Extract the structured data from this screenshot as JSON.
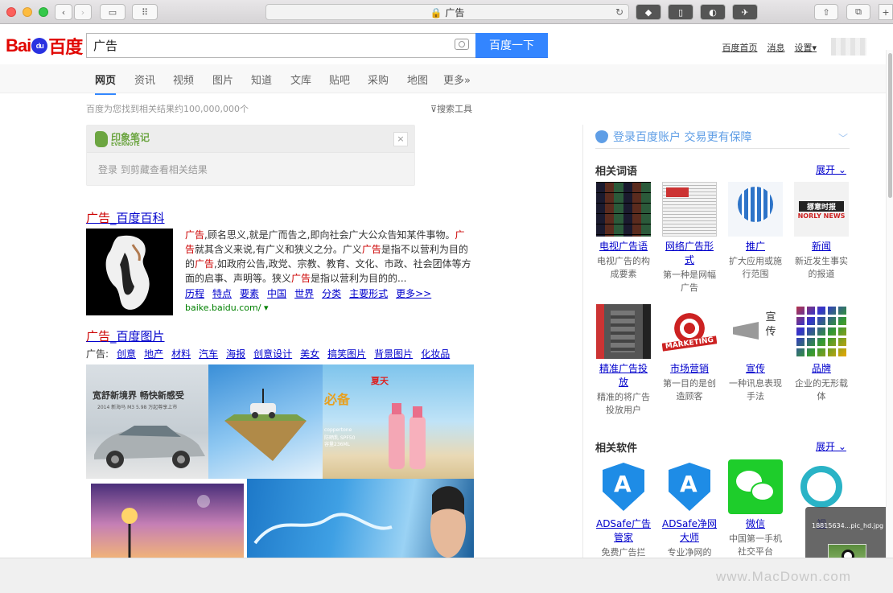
{
  "browser": {
    "address": "🔒 广告",
    "tabs_icon": "tabs-icon"
  },
  "baidu": {
    "logo_left": "Bai",
    "logo_paw": "du",
    "logo_right": "百度",
    "query": "广告",
    "search_button": "百度一下",
    "top_links": [
      "百度首页",
      "消息",
      "设置▾"
    ],
    "nav": [
      "网页",
      "资讯",
      "视频",
      "图片",
      "知道",
      "文库",
      "贴吧",
      "采购",
      "地图",
      "更多»"
    ],
    "result_count": "百度为您找到相关结果约100,000,000个",
    "search_tools": "搜索工具"
  },
  "evernote": {
    "brand": "印象笔记",
    "sub": "EVERNOTE",
    "close": "×",
    "body": "登录 到剪藏查看相关结果"
  },
  "result1": {
    "title_kw": "广告",
    "title_rest": "_百度百科",
    "text_parts": [
      "广告",
      ",顾名思义,就是广而告之,即向社会广大公众告知某件事物。",
      "广告",
      "就其含义来说,有广义和狭义之分。广义",
      "广告",
      "是指不以营利为目的的",
      "广告",
      ",如政府公告,政党、宗教、教育、文化、市政、社会团体等方面的启事、声明等。狭义",
      "广告",
      "是指以营利为目的的..."
    ],
    "links": [
      "历程",
      "特点",
      "要素",
      "中国",
      "世界",
      "分类",
      "主要形式",
      "更多>>"
    ],
    "url": "baike.baidu.com/ ▾"
  },
  "result2": {
    "title_kw": "广告",
    "title_rest": "_百度图片",
    "tag_prefix": "广告:",
    "tags": [
      "创意",
      "地产",
      "材料",
      "汽车",
      "海报",
      "创意设计",
      "美女",
      "搞笑图片",
      "背景图片",
      "化妆品"
    ],
    "car_ad_headline": "宽舒新境界  畅快新感受",
    "car_ad_sub": "2014 新海马 M3  5.98 万起尊享上市",
    "summer_ad": "夏天",
    "summer_ad2": "必备",
    "sunscreen_label": "coppertone",
    "sunscreen_spf": "防晒乳 SPF50",
    "sunscreen_size": "容量236ML"
  },
  "sidebar": {
    "login_text": "登录百度账户  交易更有保障",
    "related_words_title": "相关词语",
    "related_software_title": "相关软件",
    "expand": "展开",
    "words": [
      {
        "name": "电视广告语",
        "desc": "电视广告的构成要素"
      },
      {
        "name": "网络广告形式",
        "desc": "第一种是网幅广告"
      },
      {
        "name": "推广",
        "desc": "扩大应用或施行范围"
      },
      {
        "name": "新闻",
        "desc": "新近发生事实的报道"
      },
      {
        "name": "精准广告投放",
        "desc": "精准的将广告投放用户"
      },
      {
        "name": "市场营销",
        "desc": "第一目的是创造顾客"
      },
      {
        "name": "宣传",
        "desc": "一种讯息表现手法"
      },
      {
        "name": "品牌",
        "desc": "企业的无形载体"
      }
    ],
    "news_thumb_top": "挪意时报",
    "news_thumb_bottom": "NORLY NEWS",
    "marketing_thumb": "MARKETING",
    "xuanchuan_thumb": "宣传",
    "software": [
      {
        "name": "ADSafe广告管家",
        "desc": "免费广告拦"
      },
      {
        "name": "ADSafe净网大师",
        "desc": "专业净网的"
      },
      {
        "name": "微信",
        "desc": "中国第一手机社交平台"
      },
      {
        "name": "视",
        "desc": ""
      }
    ]
  },
  "overlay": {
    "filename": "18815634...pic_hd.jpg"
  },
  "watermark": "www.MacDown.com",
  "colors": {
    "accent": "#3385ff",
    "link": "#0000cc",
    "highlight": "#cc0000",
    "url_green": "#008000"
  }
}
